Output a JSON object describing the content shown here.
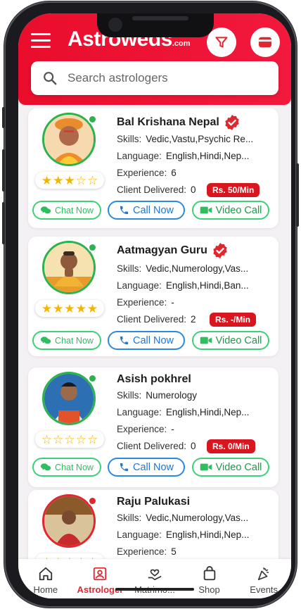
{
  "app": {
    "brand": "Astroweds",
    "brand_suffix": ".com"
  },
  "search": {
    "placeholder": "Search astrologers"
  },
  "labels": {
    "skills": "Skills:",
    "language": "Language:",
    "experience": "Experience:",
    "client_delivered": "Client Delivered:",
    "chat": "Chat Now",
    "call": "Call Now",
    "video": "Video Call"
  },
  "astrologers": [
    {
      "name": "Bal Krishana Nepal",
      "verified": true,
      "status": "online",
      "rating": 3,
      "skills": "Vedic,Vastu,Psychic Re...",
      "language": "English,Hindi,Nep...",
      "experience": "6",
      "client_delivered": "0",
      "price": "Rs. 50/Min"
    },
    {
      "name": "Aatmagyan Guru",
      "verified": true,
      "status": "online",
      "rating": 5,
      "skills": "Vedic,Numerology,Vas...",
      "language": "English,Hindi,Ban...",
      "experience": "-",
      "client_delivered": "2",
      "price": "Rs. -/Min"
    },
    {
      "name": "Asish pokhrel",
      "verified": false,
      "status": "online",
      "rating": 0,
      "skills": "Numerology",
      "language": "English,Hindi,Nep...",
      "experience": "-",
      "client_delivered": "0",
      "price": "Rs. 0/Min"
    },
    {
      "name": "Raju Palukasi",
      "verified": false,
      "status": "busy",
      "rating": 0,
      "skills": "Vedic,Numerology,Vas...",
      "language": "English,Hindi,Nep...",
      "experience": "5",
      "client_delivered": "",
      "price": ""
    }
  ],
  "bottom_nav": [
    {
      "label": "Home",
      "icon": "home-icon",
      "active": false
    },
    {
      "label": "Astrologer",
      "icon": "astrologer-icon",
      "active": true
    },
    {
      "label": "Matrimo...",
      "icon": "matrimony-icon",
      "active": false
    },
    {
      "label": "Shop",
      "icon": "shop-icon",
      "active": false
    },
    {
      "label": "Events",
      "icon": "events-icon",
      "active": false
    }
  ],
  "colors": {
    "brand_red": "#ea0d2c",
    "online": "#2bb34f",
    "busy": "#e0262f",
    "call_blue": "#1f78d1",
    "chat_green": "#2fbd5f"
  }
}
